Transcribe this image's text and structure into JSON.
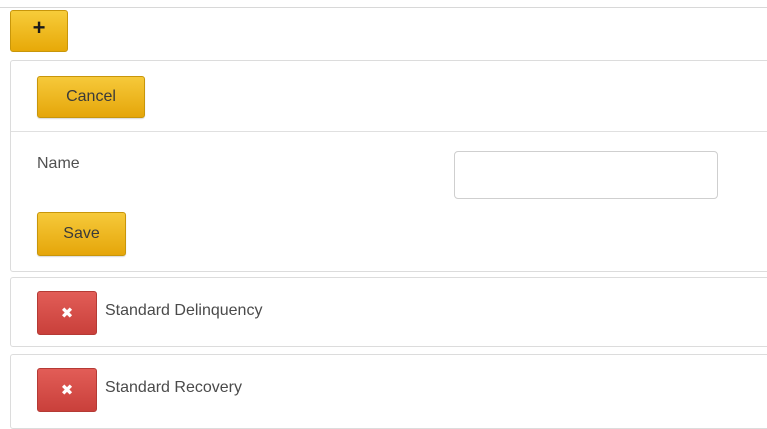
{
  "toolbar": {
    "add_label": "+"
  },
  "edit_form": {
    "cancel_label": "Cancel",
    "name_label": "Name",
    "name_value": "",
    "save_label": "Save"
  },
  "items": [
    {
      "delete_icon": "x-icon",
      "delete_glyph": "✖",
      "label": "Standard Delinquency"
    },
    {
      "delete_icon": "x-icon",
      "delete_glyph": "✖",
      "label": "Standard Recovery"
    }
  ],
  "colors": {
    "gold_button": "#e9ae10",
    "delete_button": "#d54c47"
  }
}
